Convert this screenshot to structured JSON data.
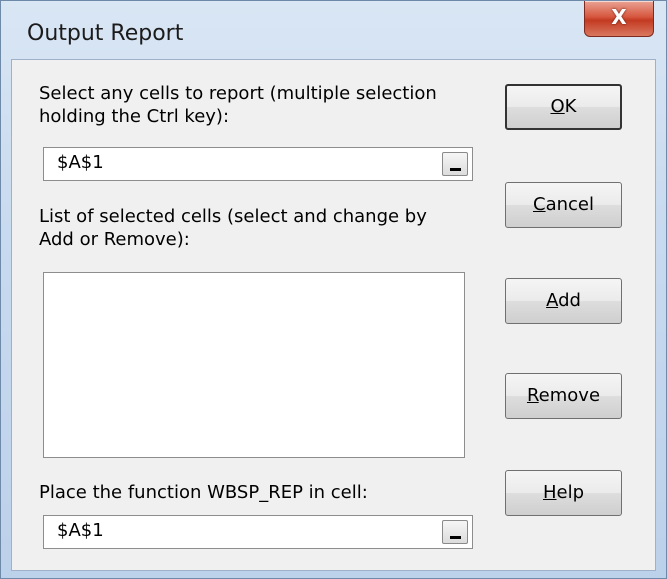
{
  "window": {
    "title": "Output Report",
    "close_glyph": "X"
  },
  "cells": {
    "label_line1": "Select any cells to report (multiple selection",
    "label_line2": "holding the Ctrl key):",
    "value": "$A$1"
  },
  "list": {
    "label_line1": "List of selected cells (select and change by",
    "label_line2": "Add or Remove):",
    "items": []
  },
  "place": {
    "label": "Place the function WBSP_REP in cell:",
    "value": "$A$1"
  },
  "buttons": {
    "ok": {
      "mnemonic": "O",
      "rest": "K"
    },
    "cancel": {
      "mnemonic": "C",
      "rest": "ancel"
    },
    "add": {
      "mnemonic": "A",
      "rest": "dd"
    },
    "remove": {
      "mnemonic": "R",
      "rest": "emove"
    },
    "help": {
      "mnemonic": "H",
      "rest": "elp"
    }
  }
}
